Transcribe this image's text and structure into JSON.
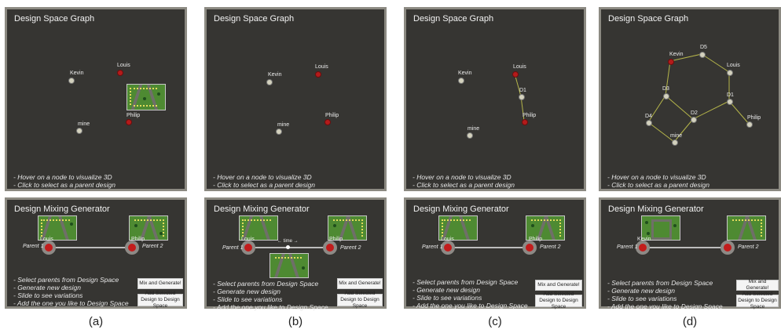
{
  "graph_title": "Design Space Graph",
  "mixer_title": "Design Mixing Generator",
  "graph_hints": [
    "- Hover on a node to visualize 3D",
    "- Click to select as a parent design"
  ],
  "mixer_hints": [
    "- Select parents from Design Space",
    "- Generate new design",
    "- Slide to see variations",
    "- Add the one you like to Design Space"
  ],
  "buttons": {
    "mix": "Mix and Generate!",
    "add": "Add Selected Design to Design Space"
  },
  "parent1_label": "Parent 1",
  "parent2_label": "Parent 2",
  "time_label": "← time →",
  "node_labels": {
    "kevin": "Kevin",
    "louis": "Louis",
    "mine": "mine",
    "philip": "Philip",
    "d1": "D1",
    "d2": "D2",
    "d3": "D3",
    "d4": "D4",
    "d5": "D5"
  },
  "captions": [
    "(a)",
    "(b)",
    "(c)",
    "(d)"
  ],
  "colors": {
    "panel_bg": "#363532",
    "panel_border": "#8c8a82",
    "edge": "#b5b54a",
    "selected_node": "#b41b1b",
    "node": "#d3d1bd"
  }
}
